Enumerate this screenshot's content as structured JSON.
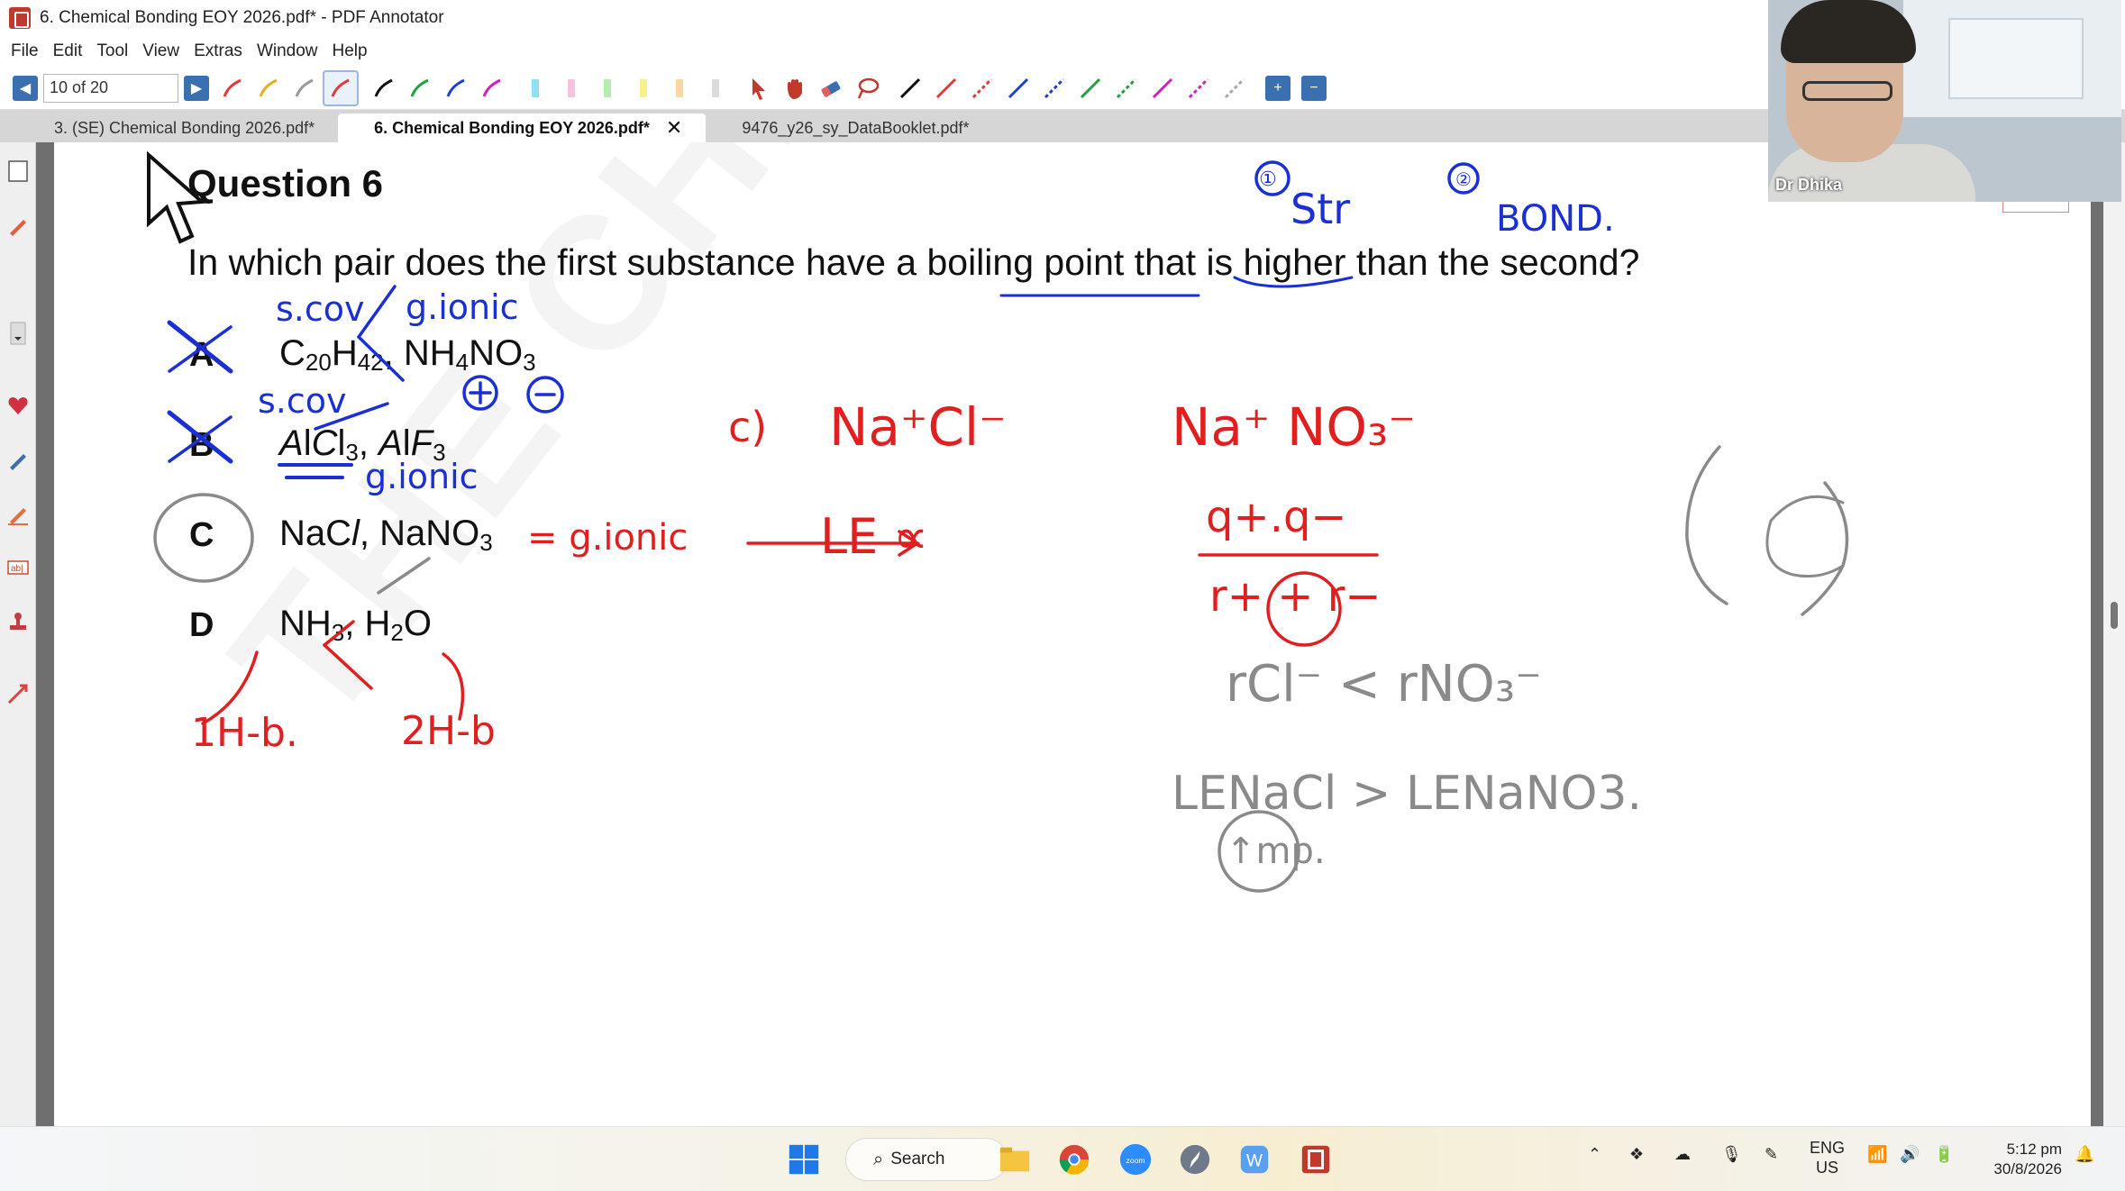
{
  "window": {
    "title": "6. Chemical Bonding EOY 2026.pdf* - PDF Annotator"
  },
  "menubar": {
    "items": [
      "File",
      "Edit",
      "Tool",
      "View",
      "Extras",
      "Window",
      "Help"
    ]
  },
  "toolbar": {
    "page_value": "10 of 20"
  },
  "tabs": [
    {
      "label": "3. (SE) Chemical Bonding 2026.pdf*"
    },
    {
      "label": "6. Chemical Bonding EOY 2026.pdf*"
    },
    {
      "label": "9476_y26_sy_DataBooklet.pdf*"
    }
  ],
  "document": {
    "heading": "Question 6",
    "question": "In which pair does the first substance have a boiling point that is higher than the second?",
    "options": [
      {
        "letter": "A",
        "first": "C20H42",
        "second": "NH4NO3"
      },
      {
        "letter": "B",
        "first": "AlCl3",
        "second": "AlF3"
      },
      {
        "letter": "C",
        "first": "NaCl",
        "second": "NaNO3"
      },
      {
        "letter": "D",
        "first": "NH3",
        "second": "H2O"
      }
    ],
    "watermark": "THE CHEMIST"
  },
  "annotations": {
    "blue": [
      "①",
      "Str",
      "②",
      "BOND.",
      "s.cov",
      "g.ionic",
      "s.cov",
      "g.ionic"
    ],
    "red": [
      "= g.ionic",
      "c)",
      "Na⁺Cl⁻",
      "Na⁺ NO₃⁻",
      "LE ∝",
      "q+.q−",
      "r+ + r−",
      "1H-b.",
      "2H-b"
    ],
    "gray": [
      "rCl⁻ < rNO₃⁻",
      "LENaCl > LENaNO3.",
      "↑mp."
    ]
  },
  "taskbar": {
    "search_label": "Search",
    "lang": "ENG",
    "region": "US",
    "time": "5:12 pm",
    "date": "30/8/2026"
  },
  "webcam": {
    "name": "Dr Dhika"
  },
  "colors": {
    "ink_blue": "#1a2fd4",
    "ink_red": "#e02020",
    "ink_gray": "#8a8a8a",
    "accent": "#3a6fb0"
  }
}
